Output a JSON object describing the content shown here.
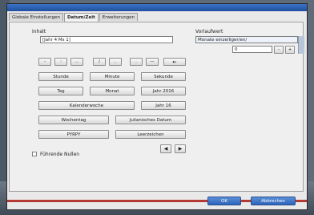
{
  "tabs": [
    {
      "label": "Globale Einstellungen"
    },
    {
      "label": "Datum/Zeit"
    },
    {
      "label": "Erweiterungen"
    }
  ],
  "inhalt": {
    "label": "Inhalt",
    "value": "[Jahr 4 Ms 1]"
  },
  "vorlauf": {
    "label": "Vorlaufwert",
    "dropdown_value": "Monate einzeiliger/en/",
    "number_value": "0"
  },
  "symbol_buttons": [
    "-",
    ":",
    "…",
    "/",
    ",",
    ".",
    "—",
    "←"
  ],
  "buttons": {
    "stunde": "Stunde",
    "minute": "Minute",
    "sekunde": "Sekunde",
    "tag": "Tag",
    "monat": "Monat",
    "jahr_2016": "Jahr 2016",
    "kalenderwoche": "Kalenderwoche",
    "jahr_16": "Jahr 16",
    "wochentag": "Wochentag",
    "julianisches_datum": "Julianisches Datum",
    "pyrpy": "PYRPY",
    "leerzeichen": "Leerzeichen"
  },
  "arrows": {
    "left": "◀",
    "right": "▶"
  },
  "stepper": {
    "minus": "–",
    "plus": "+"
  },
  "checkbox": {
    "label": "Führende Nullen"
  },
  "footer": {
    "ok": "OK",
    "cancel": "Abbrechen"
  }
}
